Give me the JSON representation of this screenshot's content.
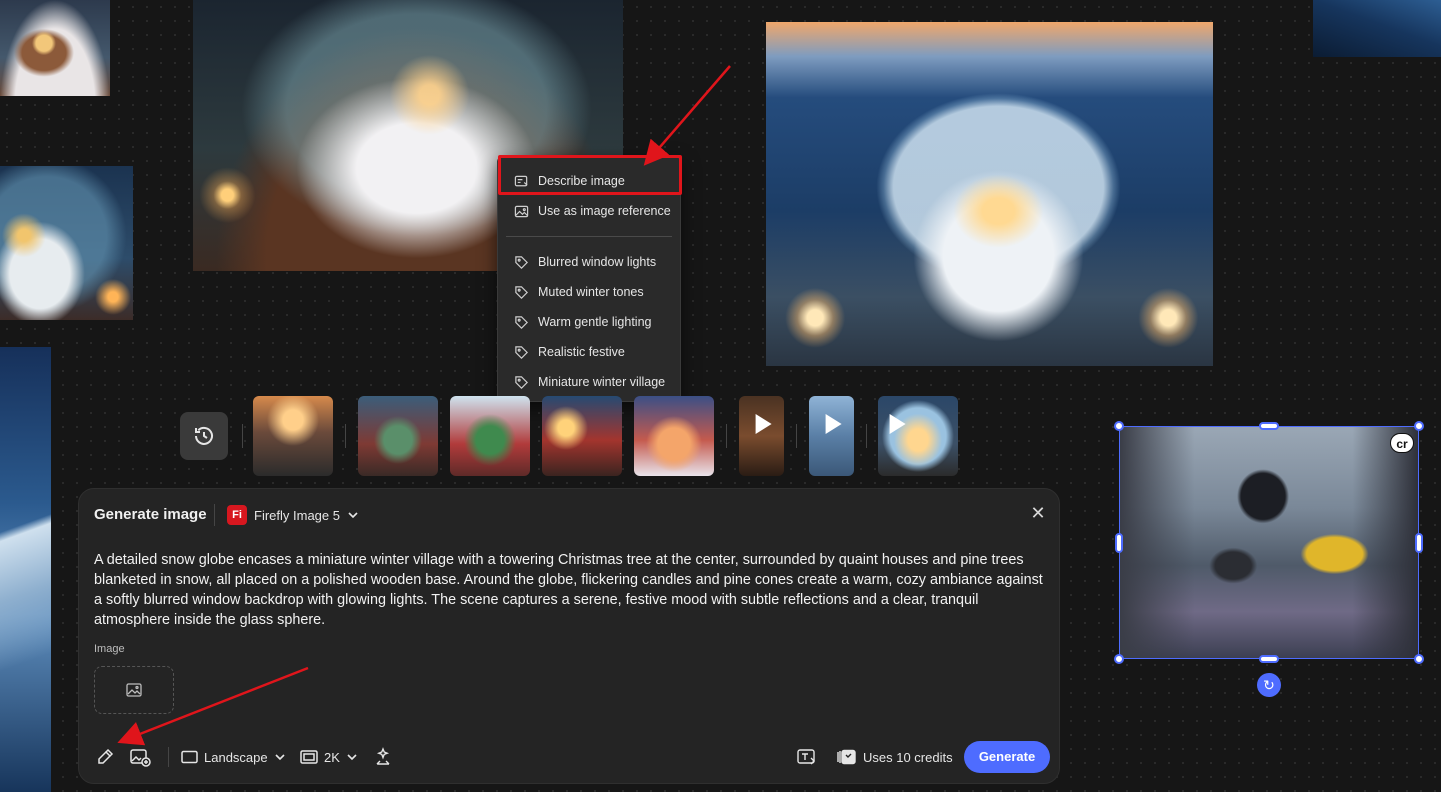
{
  "context_menu": {
    "items": [
      {
        "label": "Describe image",
        "icon": "describe-image-icon"
      },
      {
        "label": "Use as image reference",
        "icon": "image-icon"
      },
      {
        "label": "Blurred window lights",
        "icon": "tag-icon"
      },
      {
        "label": "Muted winter tones",
        "icon": "tag-icon"
      },
      {
        "label": "Warm gentle lighting",
        "icon": "tag-icon"
      },
      {
        "label": "Realistic festive",
        "icon": "tag-icon"
      },
      {
        "label": "Miniature winter village",
        "icon": "tag-icon"
      }
    ],
    "highlight_color": "#e0151b"
  },
  "canvas": {
    "badge": "cr",
    "selection_color": "#4e6cff"
  },
  "history": {
    "icon": "history-icon",
    "thumbnails": [
      {
        "kind": "image",
        "subject": "raccoons by window"
      },
      {
        "kind": "image",
        "subject": "christmas room"
      },
      {
        "kind": "image",
        "subject": "christmas window"
      },
      {
        "kind": "image",
        "subject": "festive cafe"
      },
      {
        "kind": "image",
        "subject": "gingerbread house"
      },
      {
        "kind": "video",
        "subject": "figure video"
      },
      {
        "kind": "video",
        "subject": "ice crystal video"
      },
      {
        "kind": "video",
        "subject": "snow globe video"
      }
    ]
  },
  "panel": {
    "title": "Generate image",
    "model": "Firefly Image 5",
    "model_logo": "Fi",
    "prompt": "A detailed snow globe encases a miniature winter village with a towering Christmas tree at the center, surrounded by quaint houses and pine trees blanketed in snow, all placed on a polished wooden base. Around the globe, flickering candles and pine cones create a warm, cozy ambiance against a softly blurred window backdrop with glowing lights. The scene captures a serene, festive mood with subtle reflections and a clear, tranquil atmosphere inside the glass sphere.",
    "image_label": "Image",
    "toolbar": {
      "aspect": "Landscape",
      "resolution": "2K",
      "credits": "Uses 10 credits",
      "generate": "Generate"
    },
    "accent_color": "#4e6cff"
  }
}
